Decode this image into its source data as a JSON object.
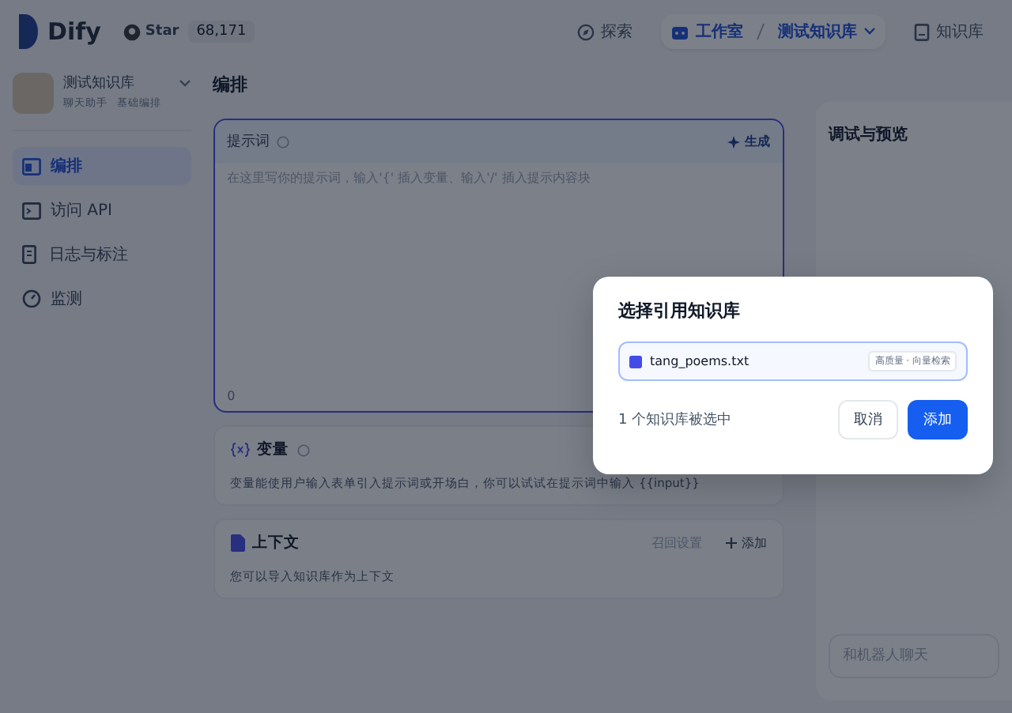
{
  "header": {
    "logo": "Dify",
    "github": {
      "label": "Star",
      "count": "68,171"
    },
    "nav": [
      {
        "label": "探索",
        "selected": false
      },
      {
        "label": "工作室",
        "selected": true,
        "current": "测试知识库"
      },
      {
        "label": "知识库",
        "selected": false
      }
    ]
  },
  "sidebar": {
    "app": {
      "name": "测试知识库",
      "tags": [
        "聊天助手",
        "基础编排"
      ]
    },
    "items": [
      {
        "label": "编排",
        "selected": true
      },
      {
        "label": "访问 API",
        "selected": false
      },
      {
        "label": "日志与标注",
        "selected": false
      },
      {
        "label": "监测",
        "selected": false
      }
    ]
  },
  "main": {
    "title": "编排",
    "prompt": {
      "label": "提示词",
      "generate": "生成",
      "placeholder": "在这里写你的提示词，输入'{' 插入变量、输入'/' 插入提示内容块",
      "count": "0"
    },
    "variables": {
      "label": "变量",
      "description": "变量能使用户输入表单引入提示词或开场白，你可以试试在提示词中输入 {{input}}"
    },
    "context": {
      "label": "上下文",
      "recall": "召回设置",
      "add": "添加",
      "description": "您可以导入知识库作为上下文"
    }
  },
  "preview": {
    "title": "调试与预览",
    "input_placeholder": "和机器人聊天"
  },
  "dialog": {
    "title": "选择引用知识库",
    "datasets": [
      {
        "name": "tang_poems.txt",
        "tag": "高质量 · 向量检索",
        "selected": true
      }
    ],
    "summary": "1 个知识库被选中",
    "buttons": [
      {
        "label": "取消",
        "kind": "secondary"
      },
      {
        "label": "添加",
        "kind": "primary"
      }
    ]
  }
}
